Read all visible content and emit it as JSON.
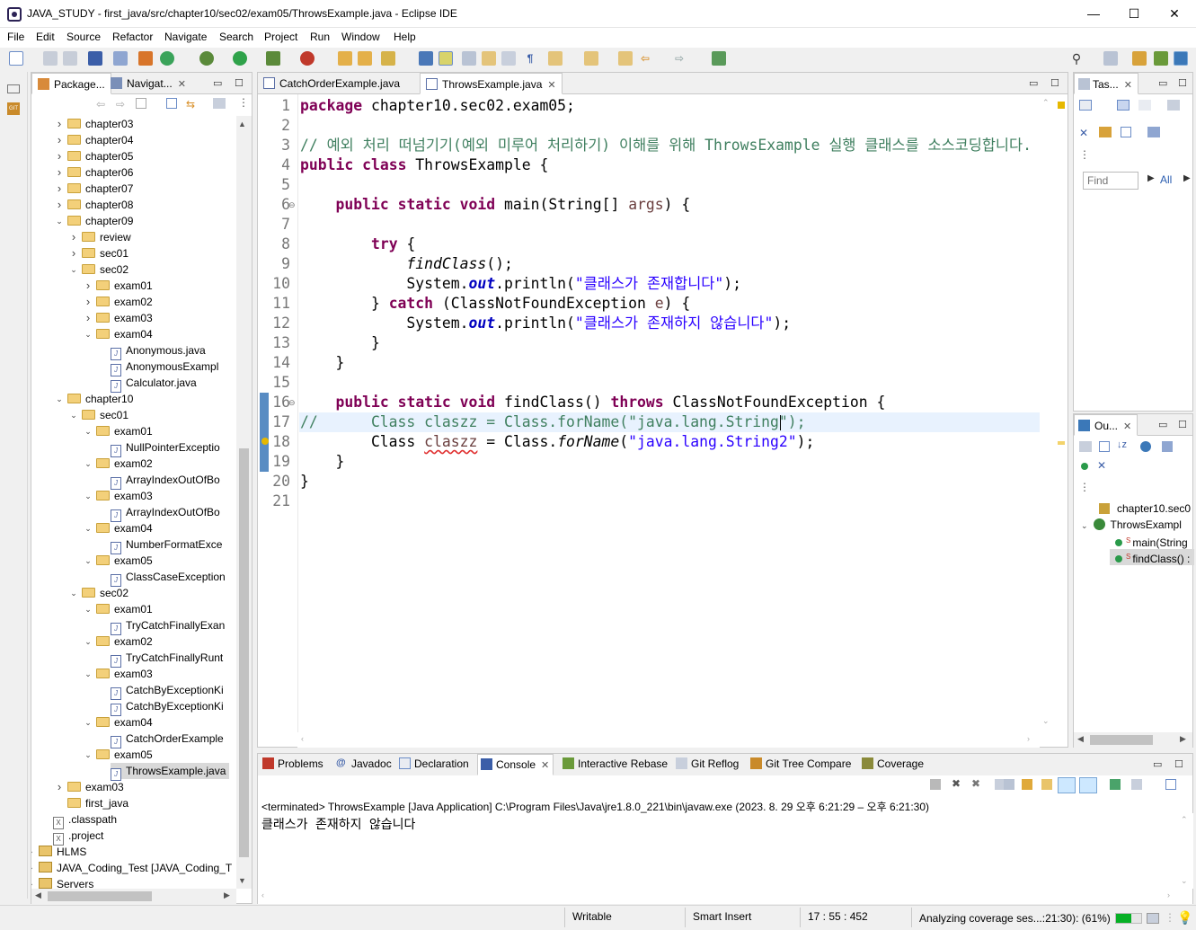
{
  "window": {
    "title": "JAVA_STUDY - first_java/src/chapter10/sec02/exam05/ThrowsExample.java - Eclipse IDE",
    "minimize": "—",
    "maximize": "☐",
    "close": "✕"
  },
  "menu": [
    "File",
    "Edit",
    "Source",
    "Refactor",
    "Navigate",
    "Search",
    "Project",
    "Run",
    "Window",
    "Help"
  ],
  "explorer": {
    "tabs": [
      {
        "label": "Package...",
        "icon": "package-explorer-icon"
      },
      {
        "label": "Navigat...",
        "icon": "navigator-icon"
      }
    ],
    "tree": [
      {
        "label": "chapter03",
        "type": "folder",
        "expanded": false
      },
      {
        "label": "chapter04",
        "type": "folder",
        "expanded": false
      },
      {
        "label": "chapter05",
        "type": "folder",
        "expanded": false
      },
      {
        "label": "chapter06",
        "type": "folder",
        "expanded": false
      },
      {
        "label": "chapter07",
        "type": "folder",
        "expanded": false
      },
      {
        "label": "chapter08",
        "type": "folder",
        "expanded": false
      },
      {
        "label": "chapter09",
        "type": "folder",
        "expanded": true
      },
      {
        "label": "review",
        "type": "folder",
        "expanded": false
      },
      {
        "label": "sec01",
        "type": "folder",
        "expanded": false
      },
      {
        "label": "sec02",
        "type": "folder",
        "expanded": true
      },
      {
        "label": "exam01",
        "type": "folder",
        "expanded": false
      },
      {
        "label": "exam02",
        "type": "folder",
        "expanded": false
      },
      {
        "label": "exam03",
        "type": "folder",
        "expanded": false
      },
      {
        "label": "exam04",
        "type": "folder",
        "expanded": true
      },
      {
        "label": "Anonymous.java",
        "type": "java"
      },
      {
        "label": "AnonymousExampl",
        "type": "java"
      },
      {
        "label": "Calculator.java",
        "type": "java"
      },
      {
        "label": "chapter10",
        "type": "folder",
        "expanded": true
      },
      {
        "label": "sec01",
        "type": "folder",
        "expanded": true
      },
      {
        "label": "exam01",
        "type": "folder",
        "expanded": true
      },
      {
        "label": "NullPointerExceptio",
        "type": "java"
      },
      {
        "label": "exam02",
        "type": "folder",
        "expanded": true
      },
      {
        "label": "ArrayIndexOutOfBo",
        "type": "java"
      },
      {
        "label": "exam03",
        "type": "folder",
        "expanded": true
      },
      {
        "label": "ArrayIndexOutOfBo",
        "type": "java"
      },
      {
        "label": "exam04",
        "type": "folder",
        "expanded": true
      },
      {
        "label": "NumberFormatExce",
        "type": "java"
      },
      {
        "label": "exam05",
        "type": "folder",
        "expanded": true
      },
      {
        "label": "ClassCaseException",
        "type": "java"
      },
      {
        "label": "sec02",
        "type": "folder",
        "expanded": true
      },
      {
        "label": "exam01",
        "type": "folder",
        "expanded": true
      },
      {
        "label": "TryCatchFinallyExan",
        "type": "java"
      },
      {
        "label": "exam02",
        "type": "folder",
        "expanded": true
      },
      {
        "label": "TryCatchFinallyRunt",
        "type": "java"
      },
      {
        "label": "exam03",
        "type": "folder",
        "expanded": true
      },
      {
        "label": "CatchByExceptionKi",
        "type": "java"
      },
      {
        "label": "CatchByExceptionKi",
        "type": "java"
      },
      {
        "label": "exam04",
        "type": "folder",
        "expanded": true
      },
      {
        "label": "CatchOrderExample",
        "type": "java"
      },
      {
        "label": "exam05",
        "type": "folder",
        "expanded": true
      },
      {
        "label": "ThrowsExample.java",
        "type": "java",
        "selected": true
      },
      {
        "label": "exam03",
        "type": "folder",
        "expanded": false
      },
      {
        "label": "first_java",
        "type": "folder"
      },
      {
        "label": ".classpath",
        "type": "xml"
      },
      {
        "label": ".project",
        "type": "xml"
      },
      {
        "label": "HLMS",
        "type": "project",
        "expanded": false
      },
      {
        "label": "JAVA_Coding_Test [JAVA_Coding_T",
        "type": "project",
        "expanded": false
      },
      {
        "label": "Servers",
        "type": "project",
        "expanded": false
      }
    ]
  },
  "editor": {
    "tabs": [
      {
        "label": "CatchOrderExample.java",
        "active": false
      },
      {
        "label": "ThrowsExample.java",
        "active": true
      }
    ],
    "line_numbers": [
      "1",
      "2",
      "3",
      "4",
      "5",
      "6",
      "7",
      "8",
      "9",
      "10",
      "11",
      "12",
      "13",
      "14",
      "15",
      "16",
      "17",
      "18",
      "19",
      "20",
      "21"
    ],
    "lines": [
      [
        {
          "t": "package",
          "c": "kw"
        },
        {
          "t": " chapter10.sec02.exam05;",
          "c": ""
        }
      ],
      [],
      [
        {
          "t": "// 예외 처리 떠넘기기(예외 미루어 처리하기) 이해를 위해 ThrowsExample 실행 클래스를 소스코딩합니다.",
          "c": "cm"
        }
      ],
      [
        {
          "t": "public",
          "c": "kw"
        },
        {
          "t": " ",
          "c": ""
        },
        {
          "t": "class",
          "c": "kw"
        },
        {
          "t": " ThrowsExample {",
          "c": ""
        }
      ],
      [],
      [
        {
          "t": "    ",
          "c": ""
        },
        {
          "t": "public",
          "c": "kw"
        },
        {
          "t": " ",
          "c": ""
        },
        {
          "t": "static",
          "c": "kw"
        },
        {
          "t": " ",
          "c": ""
        },
        {
          "t": "void",
          "c": "kw"
        },
        {
          "t": " main(String[] ",
          "c": ""
        },
        {
          "t": "args",
          "c": "var"
        },
        {
          "t": ") {",
          "c": ""
        }
      ],
      [],
      [
        {
          "t": "        ",
          "c": ""
        },
        {
          "t": "try",
          "c": "kw"
        },
        {
          "t": " {",
          "c": ""
        }
      ],
      [
        {
          "t": "            ",
          "c": ""
        },
        {
          "t": "findClass",
          "c": "it"
        },
        {
          "t": "();",
          "c": ""
        }
      ],
      [
        {
          "t": "            System.",
          "c": ""
        },
        {
          "t": "out",
          "c": "fld"
        },
        {
          "t": ".println(",
          "c": ""
        },
        {
          "t": "\"클래스가 존재합니다\"",
          "c": "str"
        },
        {
          "t": ");",
          "c": ""
        }
      ],
      [
        {
          "t": "        } ",
          "c": ""
        },
        {
          "t": "catch",
          "c": "kw"
        },
        {
          "t": " (ClassNotFoundException ",
          "c": ""
        },
        {
          "t": "e",
          "c": "var"
        },
        {
          "t": ") {",
          "c": ""
        }
      ],
      [
        {
          "t": "            System.",
          "c": ""
        },
        {
          "t": "out",
          "c": "fld"
        },
        {
          "t": ".println(",
          "c": ""
        },
        {
          "t": "\"클래스가 존재하지 않습니다\"",
          "c": "str"
        },
        {
          "t": ");",
          "c": ""
        }
      ],
      [
        {
          "t": "        }",
          "c": ""
        }
      ],
      [
        {
          "t": "    }",
          "c": ""
        }
      ],
      [],
      [
        {
          "t": "    ",
          "c": ""
        },
        {
          "t": "public",
          "c": "kw"
        },
        {
          "t": " ",
          "c": ""
        },
        {
          "t": "static",
          "c": "kw"
        },
        {
          "t": " ",
          "c": ""
        },
        {
          "t": "void",
          "c": "kw"
        },
        {
          "t": " findClass() ",
          "c": ""
        },
        {
          "t": "throws",
          "c": "kw"
        },
        {
          "t": " ClassNotFoundException {",
          "c": ""
        }
      ],
      [
        {
          "t": "//      Class claszz = Class.forName(\"java.lang.String\");",
          "c": "cm"
        }
      ],
      [
        {
          "t": "        Class ",
          "c": ""
        },
        {
          "t": "claszz",
          "c": "var sq"
        },
        {
          "t": " = Class.",
          "c": ""
        },
        {
          "t": "forName",
          "c": "it"
        },
        {
          "t": "(",
          "c": ""
        },
        {
          "t": "\"java.lang.String2\"",
          "c": "str"
        },
        {
          "t": ");",
          "c": ""
        }
      ],
      [
        {
          "t": "    }",
          "c": ""
        }
      ],
      [
        {
          "t": "}",
          "c": ""
        }
      ],
      []
    ]
  },
  "task_panel": {
    "tab": "Tas...",
    "find_placeholder": "Find",
    "all_label": "All"
  },
  "outline_panel": {
    "tab": "Ou...",
    "items": [
      {
        "label": "chapter10.sec0",
        "icon": "package-icon"
      },
      {
        "label": "ThrowsExampl",
        "icon": "class-icon"
      },
      {
        "label": "main(String",
        "icon": "method-icon"
      },
      {
        "label": "findClass() :",
        "icon": "method-icon",
        "selected": true
      }
    ]
  },
  "console": {
    "tabs": [
      "Problems",
      "Javadoc",
      "Declaration",
      "Console",
      "Interactive Rebase",
      "Git Reflog",
      "Git Tree Compare",
      "Coverage"
    ],
    "header": "<terminated> ThrowsExample [Java Application] C:\\Program Files\\Java\\jre1.8.0_221\\bin\\javaw.exe  (2023. 8. 29 오후 6:21:29 – 오후 6:21:30)",
    "output": "클래스가 존재하지 않습니다"
  },
  "status": {
    "writable": "Writable",
    "insert_mode": "Smart Insert",
    "position": "17 : 55 : 452",
    "progress_text": "Analyzing coverage ses...:21:30): (61%)",
    "progress_value": 0.61
  },
  "colors": {
    "keyword": "#7f0055",
    "comment": "#3f7f5f",
    "string": "#2a00ff",
    "field": "#0000c0",
    "current_line": "#e8f2fe",
    "selection": "#cde8ff",
    "progress": "#06b025"
  }
}
